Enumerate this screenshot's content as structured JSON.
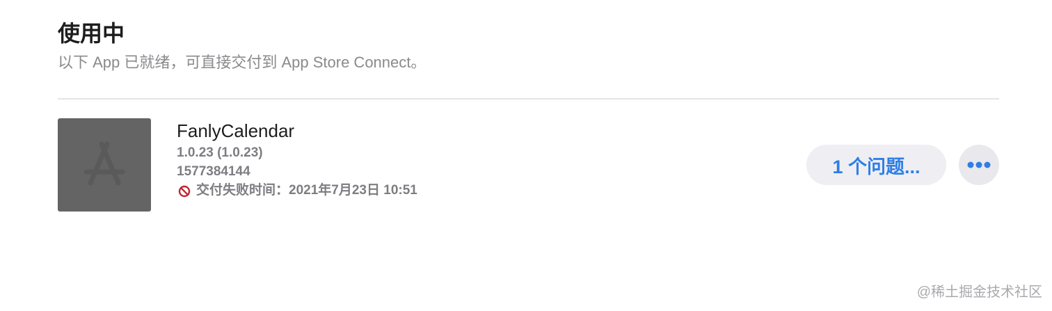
{
  "section": {
    "title": "使用中",
    "subtitle": "以下 App 已就绪，可直接交付到 App Store Connect。"
  },
  "app": {
    "name": "FanlyCalendar",
    "version": "1.0.23 (1.0.23)",
    "build_id": "1577384144",
    "status_text": "交付失败时间：2021年7月23日 10:51",
    "status_icon": "prohibited-icon",
    "icon": "app-store-placeholder-icon"
  },
  "actions": {
    "issues_label": "1 个问题...",
    "more_icon": "ellipsis-icon"
  },
  "watermark": "@稀土掘金技术社区",
  "colors": {
    "accent": "#2e7ee6",
    "error": "#c0262d",
    "icon_background": "#646464",
    "secondary_text": "#8a8a8e"
  }
}
